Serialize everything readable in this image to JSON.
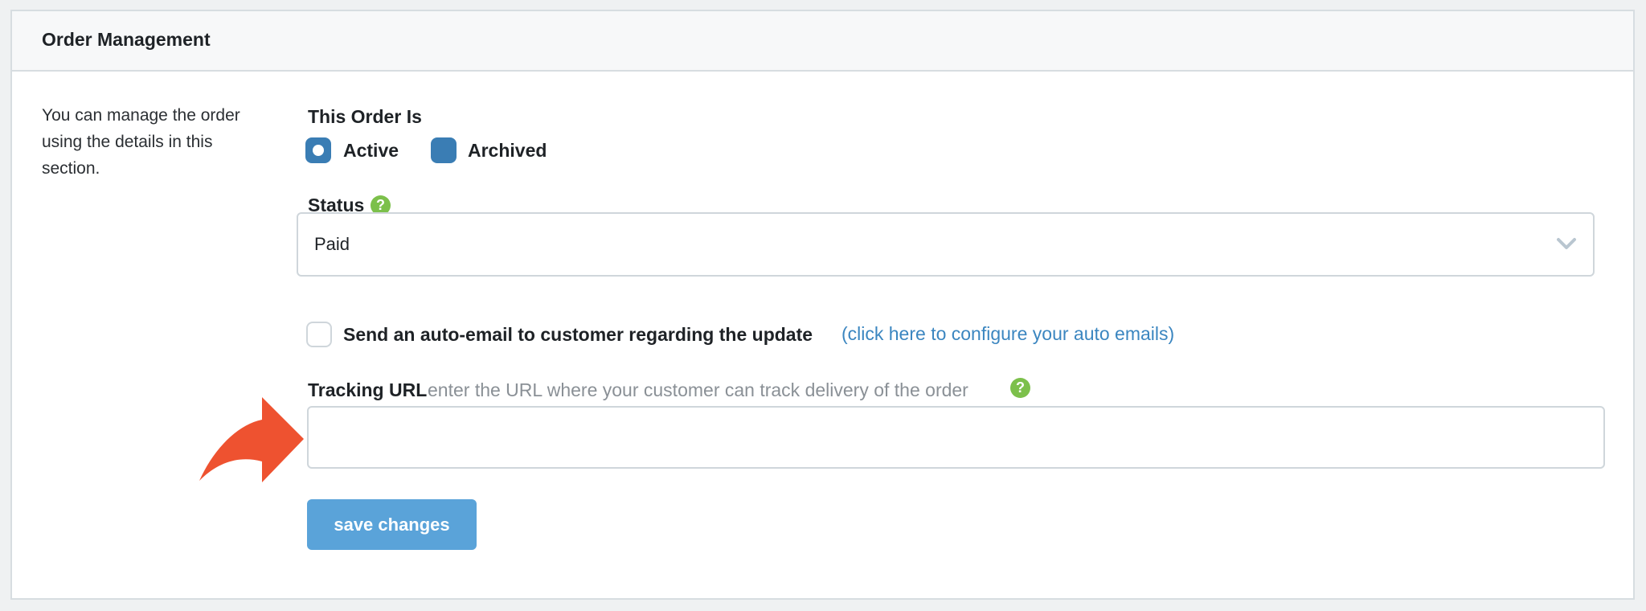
{
  "panel": {
    "title": "Order Management",
    "description": "You can manage the order using the details in this section."
  },
  "order_state": {
    "label": "This Order Is",
    "options": [
      {
        "label": "Active",
        "selected": true
      },
      {
        "label": "Archived",
        "selected": false
      }
    ]
  },
  "status": {
    "label": "Status",
    "help_icon": "question-circle-icon",
    "value": "Paid",
    "chevron_icon": "chevron-down-icon"
  },
  "auto_email": {
    "checked": false,
    "label": "Send an auto-email to customer regarding the update",
    "link": "(click here to configure your auto emails)"
  },
  "tracking": {
    "label": "Tracking URL",
    "hint": "enter the URL where your customer can track delivery of the order",
    "help_icon": "question-circle-icon",
    "value": ""
  },
  "save_button": "save changes",
  "annotation": {
    "icon": "curved-arrow-icon",
    "color": "#ee5230"
  },
  "colors": {
    "accent": "#3a7db4",
    "button": "#5aa3d9",
    "link": "#3b86c0",
    "help": "#7cc04b"
  }
}
